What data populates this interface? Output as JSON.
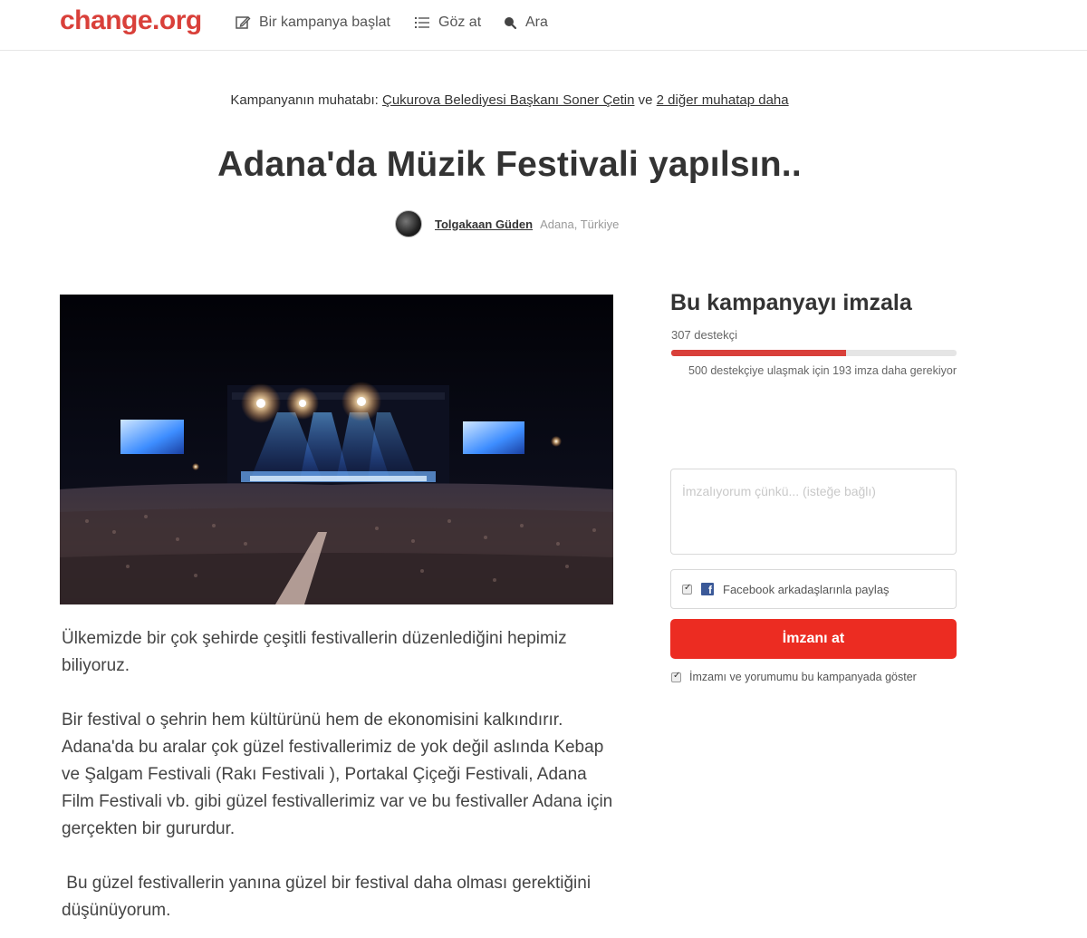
{
  "header": {
    "logo": "change.org",
    "nav": {
      "start": "Bir kampanya başlat",
      "browse": "Göz at",
      "search": "Ara"
    }
  },
  "decision_makers": {
    "prefix": "Kampanyanın muhatabı:",
    "primary": "Çukurova Belediyesi Başkanı Soner Çetin",
    "conjunction": "ve",
    "others": "2 diğer muhatap daha"
  },
  "petition": {
    "title": "Adana'da Müzik Festivali yapılsın..",
    "author": "Tolgakaan Güden",
    "location": "Adana, Türkiye",
    "story": [
      "Ülkemizde bir çok şehirde çeşitli festivallerin düzenlediğini hepimiz biliyoruz.",
      "Bir festival o şehrin hem kültürünü hem de ekonomisini kalkındırır. Adana'da bu aralar çok güzel festivallerimiz de yok değil aslında Kebap ve Şalgam Festivali (Rakı Festivali ), Portakal Çiçeği Festivali, Adana Film Festivali vb. gibi güzel festivallerimiz var ve bu festivaller Adana için gerçekten bir gururdur.",
      " Bu güzel festivallerin yanına güzel bir festival daha olması gerektiğini düşünüyorum."
    ]
  },
  "sign_panel": {
    "title": "Bu kampanyayı imzala",
    "supporters": "307 destekçi",
    "progress_fraction": 0.614,
    "goal_text": "500 destekçiye ulaşmak için 193 imza daha gerekiyor",
    "reason_placeholder": "İmzalıyorum çünkü... (isteğe bağlı)",
    "facebook_share": "Facebook arkadaşlarınla paylaş",
    "sign_button": "İmzanı at",
    "display_option": "İmzamı ve yorumumu bu kampanyada göster"
  },
  "colors": {
    "brand": "#d9403a",
    "button": "#ec2c22",
    "facebook": "#3b5998"
  }
}
